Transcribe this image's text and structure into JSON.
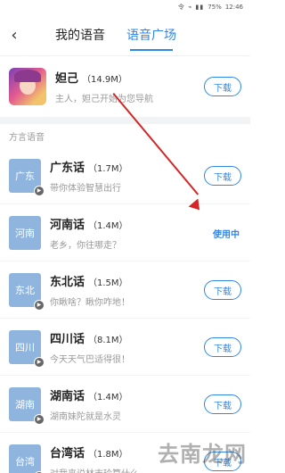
{
  "status_bar": {
    "icons": "令 ⌁ ▮▮",
    "battery": "75%",
    "time": "12:46"
  },
  "header": {
    "tabs": [
      {
        "label": "我的语音",
        "active": false
      },
      {
        "label": "语音广场",
        "active": true
      }
    ]
  },
  "featured": {
    "title": "妲己",
    "size": "（14.9M）",
    "subtitle": "主人，妲己开始为您导航",
    "action": "下载"
  },
  "section": {
    "label": "方言语音"
  },
  "dialects": [
    {
      "badge": "广东",
      "title": "广东话",
      "size": "（1.7M）",
      "subtitle": "带你体验智慧出行",
      "action": "下载",
      "state": "download"
    },
    {
      "badge": "河南",
      "title": "河南话",
      "size": "（1.4M）",
      "subtitle": "老乡，你往哪走？",
      "action": "使用中",
      "state": "in-use"
    },
    {
      "badge": "东北",
      "title": "东北话",
      "size": "（1.5M）",
      "subtitle": "你瞅啥？瞅你咋地！",
      "action": "下载",
      "state": "download"
    },
    {
      "badge": "四川",
      "title": "四川话",
      "size": "（8.1M）",
      "subtitle": "今天天气巴适得很！",
      "action": "下载",
      "state": "download"
    },
    {
      "badge": "湖南",
      "title": "湖南话",
      "size": "（1.4M）",
      "subtitle": "湖南妹陀就是水灵",
      "action": "下载",
      "state": "download"
    },
    {
      "badge": "台湾",
      "title": "台湾话",
      "size": "（1.8M）",
      "subtitle": "对我来说林志玲算什么",
      "action": "下载",
      "state": "download"
    }
  ],
  "watermark": "去南龙网",
  "colors": {
    "accent": "#2f87e6",
    "annotation": "#d32626",
    "badge": "#8fb5df"
  }
}
